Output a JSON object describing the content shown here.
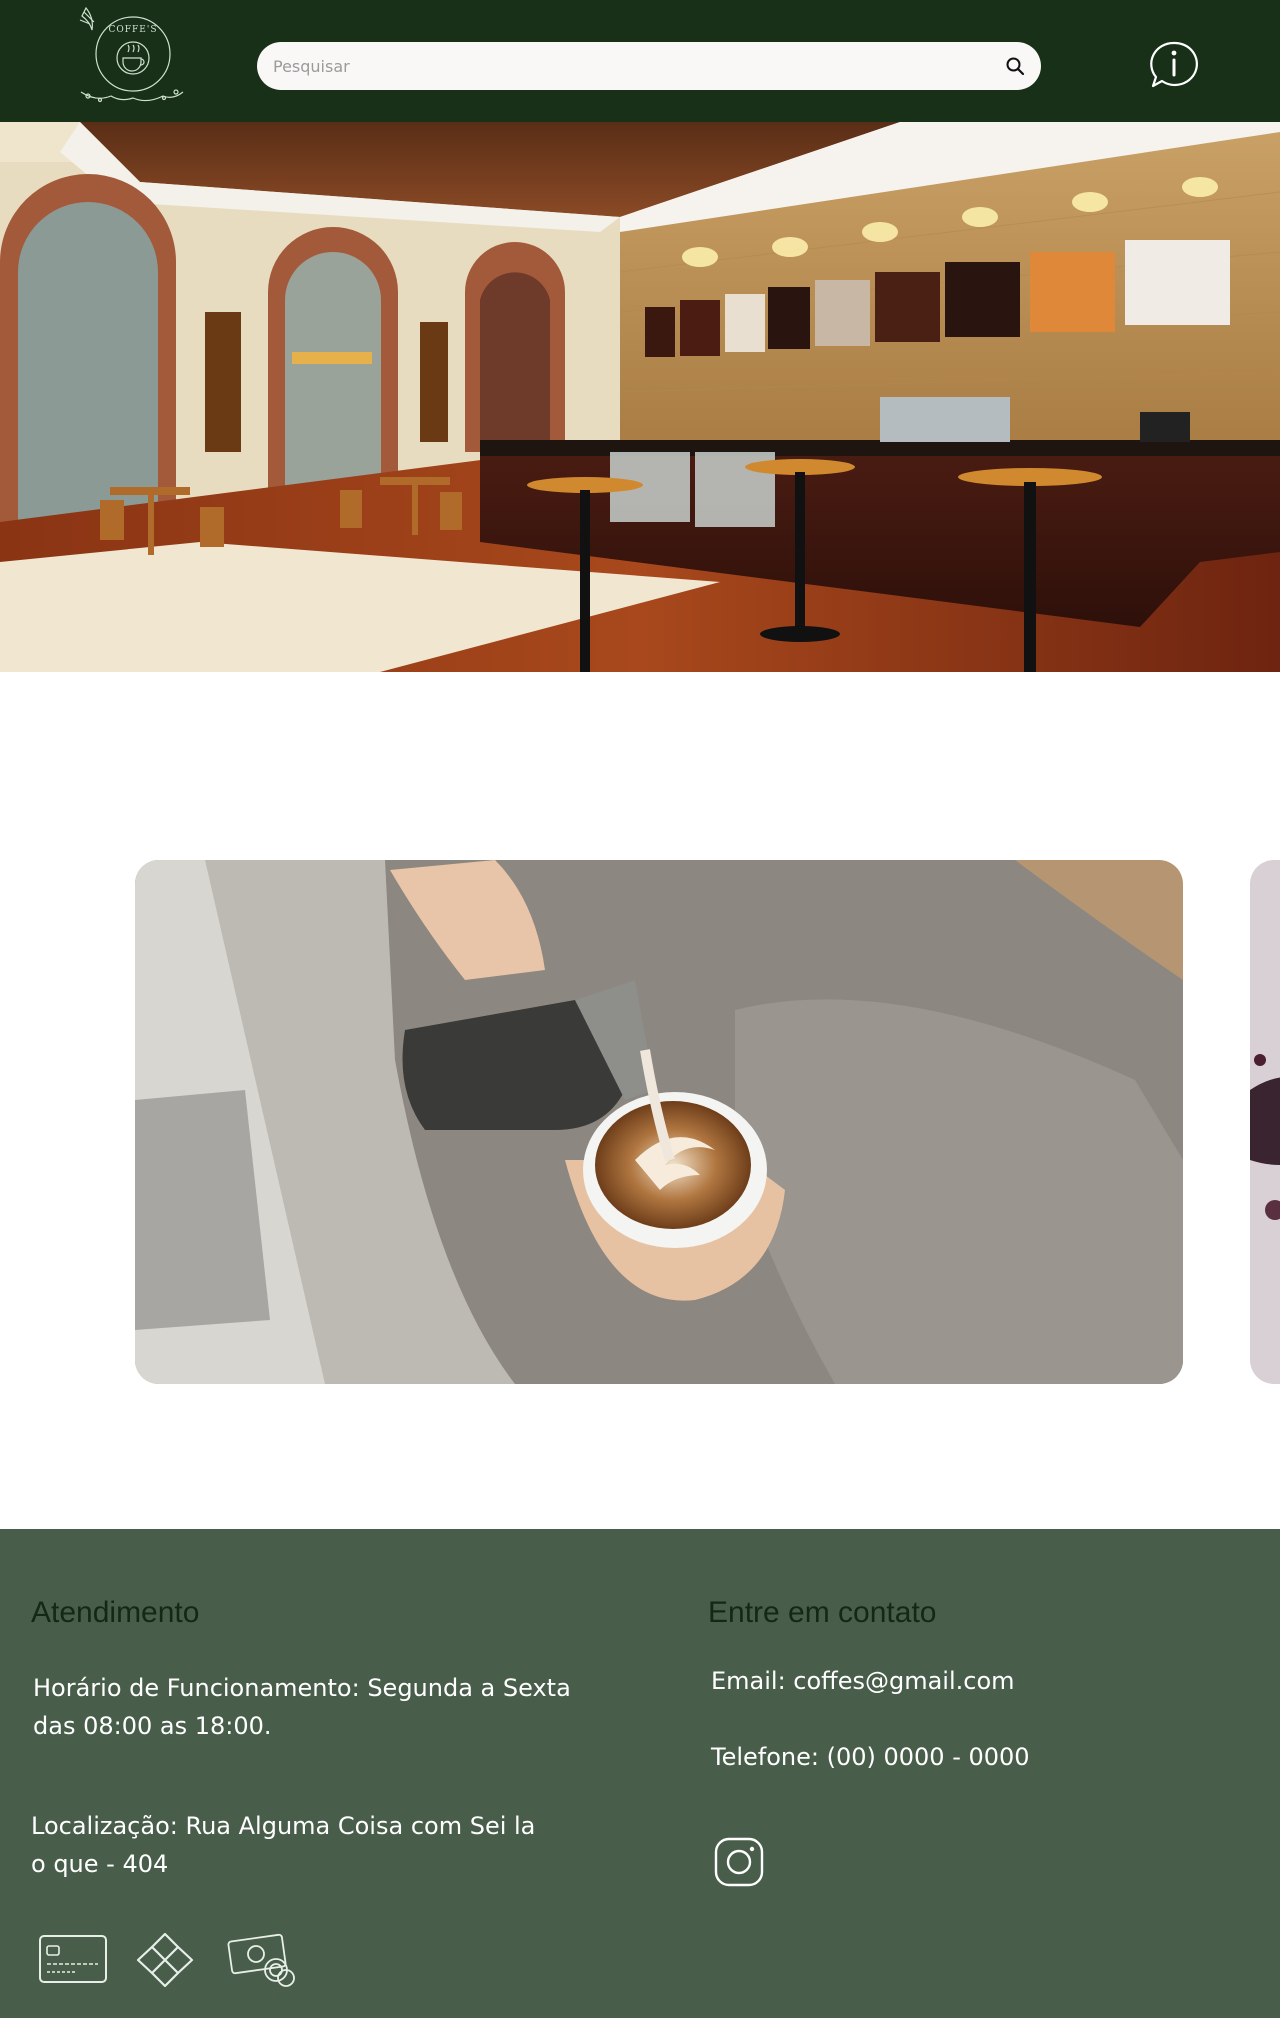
{
  "header": {
    "logo_icon": "coffees-logo",
    "logo_text": "COFFE'S",
    "search": {
      "placeholder": "Pesquisar",
      "value": "",
      "icon": "search-icon"
    },
    "info_icon": "info-chat-icon"
  },
  "hero": {
    "image": "coffee-shop-interior-photo"
  },
  "carousel": {
    "slides": [
      {
        "image": "latte-art-pouring-photo"
      },
      {
        "image": "coffee-beans-photo"
      }
    ]
  },
  "footer": {
    "atendimento": {
      "title": "Atendimento",
      "hours": "Horário de Funcionamento: Segunda a Sexta das 08:00 as 18:00.",
      "location": "Localização: Rua Alguma Coisa com Sei la o que - 404",
      "payment_icons": [
        "credit-card-icon",
        "pix-icon",
        "cash-icon"
      ]
    },
    "contato": {
      "title": "Entre em contato",
      "email": "Email: coffes@gmail.com",
      "phone": "Telefone: (00) 0000 - 0000",
      "social_icon": "instagram-icon"
    }
  },
  "colors": {
    "header_bg": "#173017",
    "footer_bg": "#485e4b",
    "heading": "#142914"
  }
}
